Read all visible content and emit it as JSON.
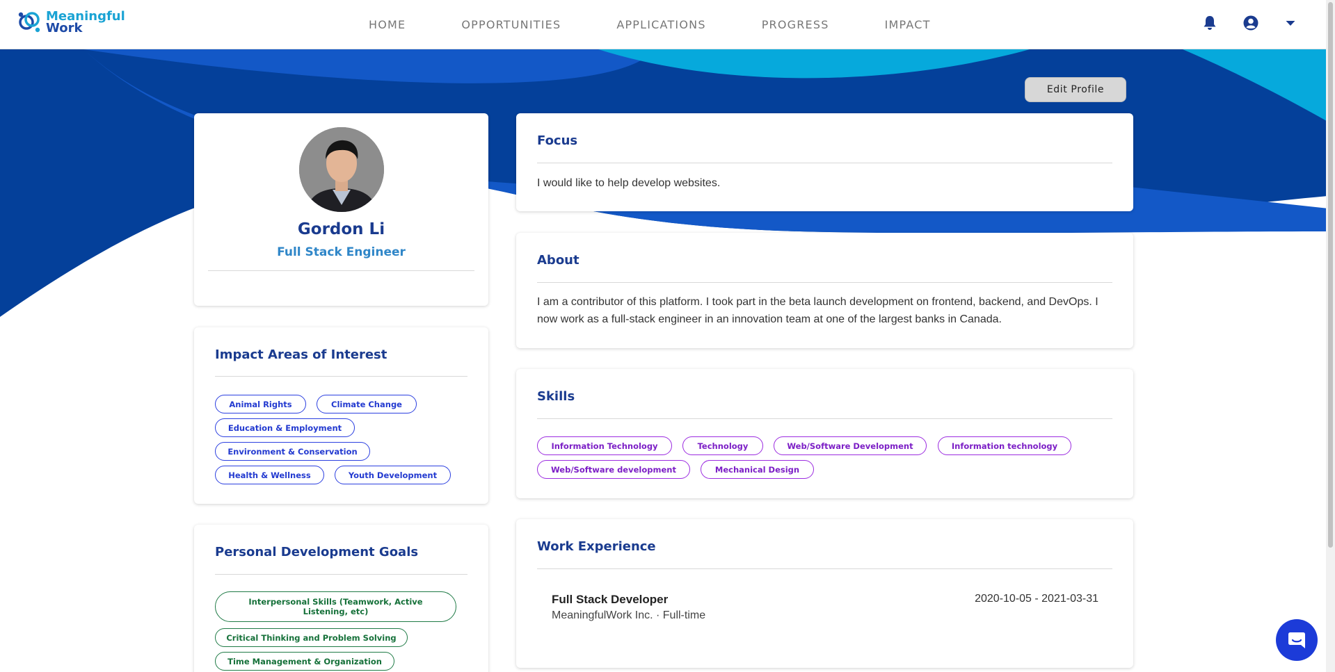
{
  "brand": {
    "line1": "Meaningful",
    "line2": "Work"
  },
  "nav": [
    "HOME",
    "OPPORTUNITIES",
    "APPLICATIONS",
    "PROGRESS",
    "IMPACT"
  ],
  "colors": {
    "navy": "#1a3b8f",
    "banner_dark": "#04409a",
    "banner_mid": "#1358c7",
    "banner_cyan": "#06a9dc",
    "pill_blue": "#233ad0",
    "pill_purple": "#7c1fc6",
    "pill_green": "#16713a",
    "chat": "#1c3bd8"
  },
  "header_icons": [
    "bell-icon",
    "user-circle-icon",
    "caret-down-icon"
  ],
  "edit_profile": "Edit Profile",
  "profile": {
    "name": "Gordon Li",
    "role": "Full Stack Engineer"
  },
  "impact": {
    "title": "Impact Areas of Interest",
    "tags": [
      "Animal Rights",
      "Climate Change",
      "Education & Employment",
      "Environment & Conservation",
      "Health & Wellness",
      "Youth Development"
    ]
  },
  "goals": {
    "title": "Personal Development Goals",
    "tags": [
      "Interpersonal Skills (Teamwork, Active Listening, etc)",
      "Critical Thinking and Problem Solving",
      "Time Management & Organization"
    ]
  },
  "focus": {
    "title": "Focus",
    "text": "I would like to help develop websites."
  },
  "about": {
    "title": "About",
    "text": "I am a contributor of this platform. I took part in the beta launch development on frontend, backend, and DevOps. I now work as a full-stack engineer in an innovation team at one of the largest banks in Canada."
  },
  "skills": {
    "title": "Skills",
    "tags": [
      "Information Technology",
      "Technology",
      "Web/Software Development",
      "Information technology",
      "Web/Software development",
      "Mechanical Design"
    ]
  },
  "work": {
    "title": "Work Experience",
    "items": [
      {
        "title": "Full Stack Developer",
        "company": "MeaningfulWork Inc. · Full-time",
        "dates": "2020-10-05 - 2021-03-31"
      }
    ]
  }
}
